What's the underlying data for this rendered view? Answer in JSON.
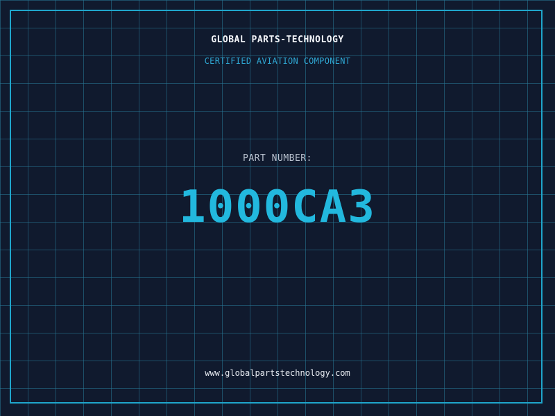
{
  "label": {
    "company": "GLOBAL PARTS-TECHNOLOGY",
    "subtitle": "CERTIFIED AVIATION COMPONENT",
    "part_label": "PART NUMBER:",
    "part_number": "1000CA3",
    "website": "www.globalpartstechnology.com"
  },
  "colors": {
    "background": "#101a2e",
    "grid": "#28789a",
    "frame": "#1fa6cc",
    "accent": "#22b8de"
  }
}
